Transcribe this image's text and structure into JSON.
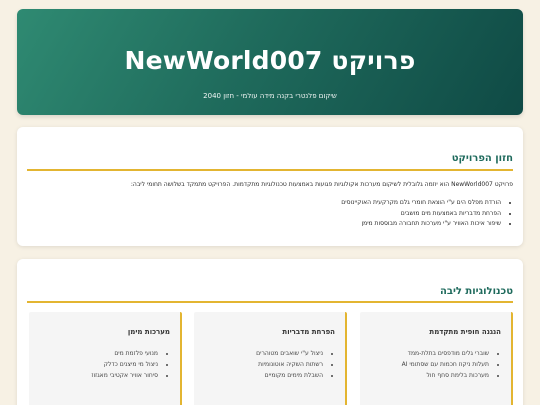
{
  "hero": {
    "title": "פרויקט NewWorld007",
    "subtitle": "שיקום פלנטרי בקנה מידה עולמי - חזון 2040"
  },
  "vision": {
    "heading": "חזון הפרויקט",
    "intro": "פרויקט NewWorld007 הוא יוזמה גלובלית לשיקום מערכות אקולוגיות פגועות באמצעות טכנולוגיות מתקדמות. הפרויקט מתמקד בשלושה תחומי ליבה:",
    "items": [
      "הורדת מפלס הים ע\"י הוצאת חומרי גלם מקרקעית האוקיינוסים",
      "הפרחת מדבריות באמצעות מים מושבים",
      "שיפור איכות האוויר ע\"י מערכות תחבורה מבוססות מימן"
    ]
  },
  "tech": {
    "heading": "טכנולוגיות ליבה",
    "boxes": [
      {
        "title": "הנגנה חופית מתקדמת",
        "items": [
          "שוברי גלים מודפסים בתלת-ממד",
          "תעלות ניקוז חכמות עם שסתומי AI",
          "מערכות בלימת סחף חול"
        ]
      },
      {
        "title": "הפרחת מדבריות",
        "items": [
          "ניצול ע\"י שואבים מטוהרים",
          "רשתות השקיה אוטונומיות",
          "השבלת מימים מקומיים"
        ]
      },
      {
        "title": "מערכות מימן",
        "items": [
          "מנועי פלזמת מים",
          "ניצול מי מיצנים כדלק",
          "סיחור אוויר אקטיבי מאגזוז"
        ]
      }
    ]
  }
}
